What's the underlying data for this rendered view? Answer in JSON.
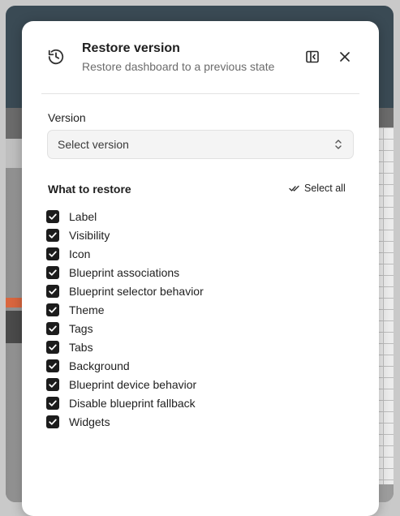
{
  "dialog": {
    "title": "Restore version",
    "subtitle": "Restore dashboard to a previous state",
    "icons": {
      "history": "history-icon",
      "panel": "panel-toggle-icon",
      "close": "close-icon"
    }
  },
  "version": {
    "label": "Version",
    "placeholder": "Select version"
  },
  "restore": {
    "label": "What to restore",
    "select_all_label": "Select all",
    "items": [
      {
        "label": "Label",
        "checked": true
      },
      {
        "label": "Visibility",
        "checked": true
      },
      {
        "label": "Icon",
        "checked": true
      },
      {
        "label": "Blueprint associations",
        "checked": true
      },
      {
        "label": "Blueprint selector behavior",
        "checked": true
      },
      {
        "label": "Theme",
        "checked": true
      },
      {
        "label": "Tags",
        "checked": true
      },
      {
        "label": "Tabs",
        "checked": true
      },
      {
        "label": "Background",
        "checked": true
      },
      {
        "label": "Blueprint device behavior",
        "checked": true
      },
      {
        "label": "Disable blueprint fallback",
        "checked": true
      },
      {
        "label": "Widgets",
        "checked": true
      }
    ]
  },
  "colors": {
    "checkbox": "#1c1c1c",
    "dialog_bg": "#ffffff",
    "muted_text": "#6b6b6b"
  }
}
